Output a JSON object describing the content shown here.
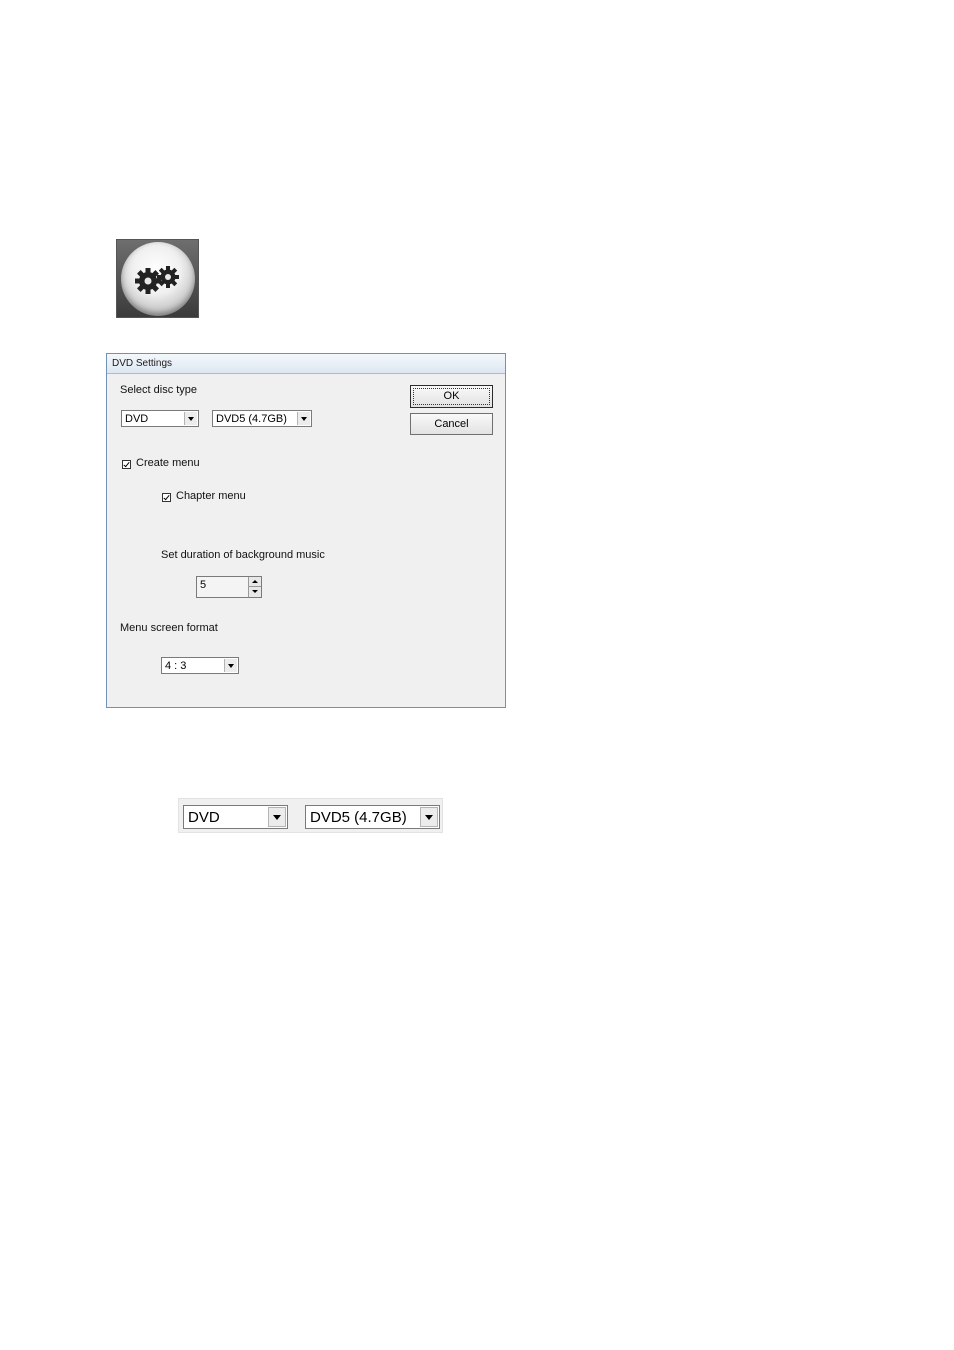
{
  "dialog": {
    "title": "DVD Settings",
    "disc_type_label": "Select disc type",
    "disc_type_value": "DVD",
    "disc_size_value": "DVD5 (4.7GB)",
    "ok_label": "OK",
    "cancel_label": "Cancel",
    "create_menu_label": "Create menu",
    "create_menu_checked": true,
    "chapter_menu_label": "Chapter menu",
    "chapter_menu_checked": true,
    "music_duration_label": "Set duration of background music",
    "music_duration_value": "5",
    "menu_format_label": "Menu screen format",
    "menu_format_value": "4 : 3"
  },
  "zoom_detail": {
    "disc_type_value": "DVD",
    "disc_size_value": "DVD5 (4.7GB)"
  },
  "icons": {
    "settings": "gears-icon"
  }
}
